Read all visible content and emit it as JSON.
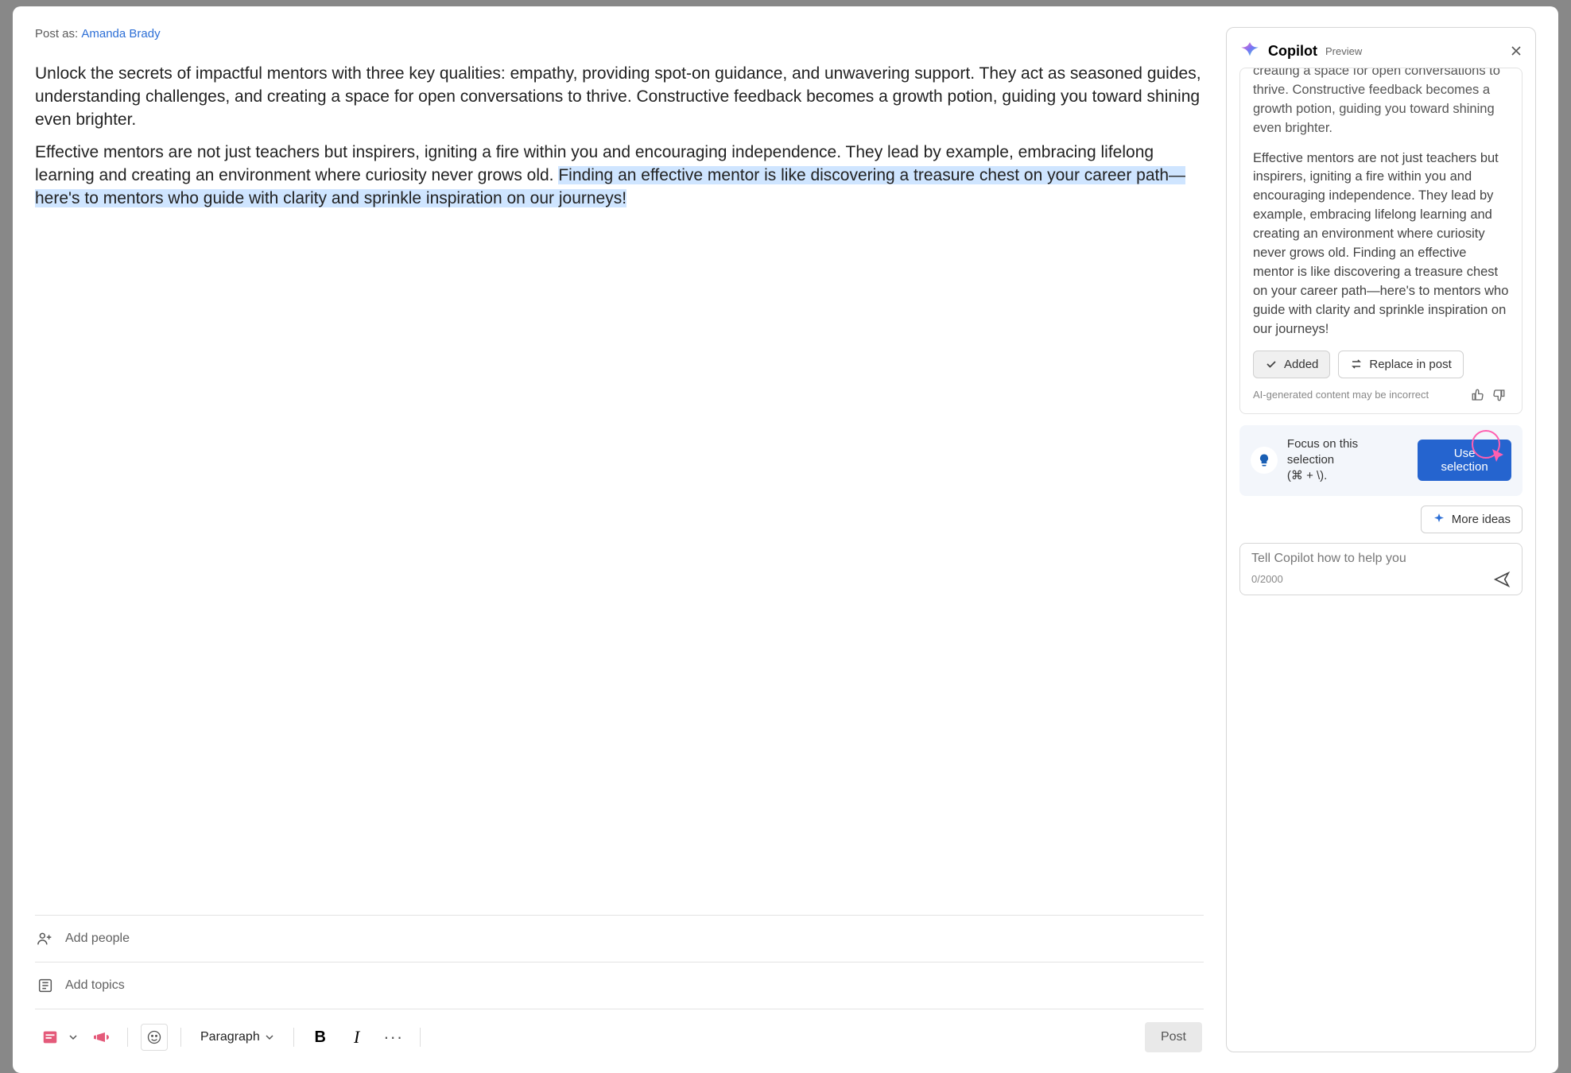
{
  "post_as_label": "Post as:",
  "post_as_name": "Amanda Brady",
  "content": {
    "p1": "Unlock the secrets of impactful mentors with three key qualities: empathy, providing spot-on guidance, and unwavering support. They act as seasoned guides, understanding challenges, and creating a space for open conversations to thrive. Constructive feedback becomes a growth potion, guiding you toward shining even brighter.",
    "p2a": "Effective mentors are not just teachers but inspirers, igniting a fire within you and encouraging independence. They lead by example, embracing lifelong learning and creating an environment where curiosity never grows old. ",
    "p2b_selected": "Finding an effective mentor is like discovering a treasure chest on your career path—here's to mentors who guide with clarity and sprinkle inspiration on our journeys!"
  },
  "bottom": {
    "add_people": "Add people",
    "add_topics": "Add topics",
    "paragraph": "Paragraph",
    "post": "Post"
  },
  "copilot": {
    "title": "Copilot",
    "preview": "Preview",
    "clip": "unwavering support. They act as seasoned guides, understanding challenges, and creating a space for open conversations to thrive. Constructive feedback becomes a growth potion, guiding you toward shining even brighter.",
    "para2": "Effective mentors are not just teachers but inspirers, igniting a fire within you and encouraging independence. They lead by example, embracing lifelong learning and creating an environment where curiosity never grows old. Finding an effective mentor is like discovering a treasure chest on your career path—here's to mentors who guide with clarity and sprinkle inspiration on our journeys!",
    "added": "Added",
    "replace": "Replace in post",
    "disclaimer": "AI-generated content may be incorrect",
    "focus_label": "Focus on this selection",
    "focus_shortcut": "(⌘ + \\).",
    "use_selection": "Use selection",
    "more_ideas": "More ideas",
    "input_placeholder": "Tell Copilot how to help you",
    "char_count": "0/2000"
  }
}
